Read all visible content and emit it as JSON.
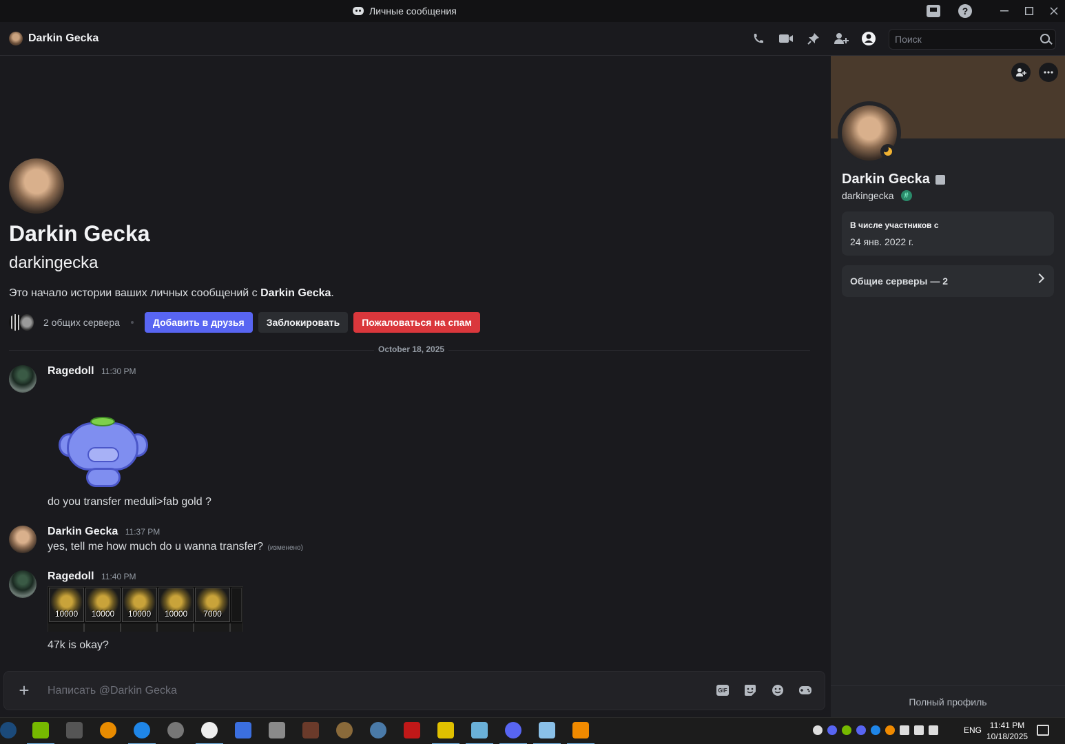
{
  "window": {
    "title": "Личные сообщения"
  },
  "header": {
    "username": "Darkin Gecka",
    "search_placeholder": "Поиск",
    "icons": [
      "phone-call-icon",
      "video-call-icon",
      "pin-icon",
      "add-friends-to-dm-icon",
      "user-profile-icon"
    ]
  },
  "intro": {
    "display_name": "Darkin Gecka",
    "username": "darkingecka",
    "text_prefix": "Это начало истории ваших личных сообщений с ",
    "text_name": "Darkin Gecka",
    "text_suffix": ".",
    "mutual_servers": "2 общих сервера",
    "add_friend": "Добавить в друзья",
    "block": "Заблокировать",
    "report_spam": "Пожаловаться на спам"
  },
  "chat": {
    "date_divider": "October 18, 2025",
    "messages": [
      {
        "author": "Ragedoll",
        "time": "11:30 PM",
        "text": "do you transfer meduli>fab gold ?"
      },
      {
        "author": "Darkin Gecka",
        "time": "11:37 PM",
        "text": "yes, tell me how much do u wanna transfer?",
        "edited": "(изменено)"
      },
      {
        "author": "Ragedoll",
        "time": "11:40 PM",
        "text": "47k is okay?"
      }
    ],
    "inventory_values": [
      "10000",
      "10000",
      "10000",
      "10000",
      "7000"
    ]
  },
  "composer": {
    "placeholder": "Написать @Darkin Gecka",
    "gif_label": "GIF"
  },
  "profile": {
    "display_name": "Darkin Gecka",
    "username": "darkingecka",
    "member_since_label": "В числе участников с",
    "member_since_value": "24 янв. 2022 г.",
    "mutual_servers": "Общие серверы — 2",
    "full_profile": "Полный профиль",
    "status_color": "#f0b232"
  },
  "taskbar": {
    "language": "ENG",
    "time": "11:41 PM",
    "date": "10/18/2025"
  },
  "colors": {
    "accent": "#5865f2",
    "danger": "#da373c",
    "background": "#1a1a1e"
  }
}
